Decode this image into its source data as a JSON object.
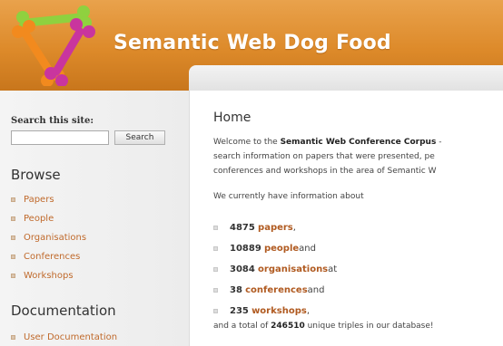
{
  "header": {
    "title": "Semantic Web Dog Food"
  },
  "search": {
    "label": "Search this site:",
    "value": "",
    "button": "Search"
  },
  "browse": {
    "heading": "Browse",
    "items": [
      "Papers",
      "People",
      "Organisations",
      "Conferences",
      "Workshops"
    ]
  },
  "documentation": {
    "heading": "Documentation",
    "items": [
      "User Documentation"
    ]
  },
  "main": {
    "title": "Home",
    "welcome": {
      "prefix": "Welcome to the ",
      "corpus": "Semantic Web Conference Corpus",
      "suffix": " -",
      "line2": "search information on papers that were presented, pe",
      "line3": "conferences and workshops in the area of Semantic W"
    },
    "intro": "We currently have information about",
    "stats": [
      {
        "number": "4875",
        "link": "papers",
        "tail": ","
      },
      {
        "number": "10889",
        "link": "people",
        "tail": " and"
      },
      {
        "number": "3084",
        "link": "organisations",
        "tail": " at"
      },
      {
        "number": "38",
        "link": "conferences",
        "tail": " and"
      },
      {
        "number": "235",
        "link": "workshops",
        "tail": ","
      }
    ],
    "summary": {
      "prefix": "and a total of ",
      "number": "246510",
      "suffix": " unique triples in our database!"
    }
  },
  "colors": {
    "header_orange": "#dd8a2a",
    "link_brown": "#b05a20",
    "bone_green": "#8fd13f",
    "bone_orange": "#f28a1e",
    "bone_magenta": "#c9359e"
  },
  "icons": {
    "logo": "dog-bones-triangle-logo"
  }
}
